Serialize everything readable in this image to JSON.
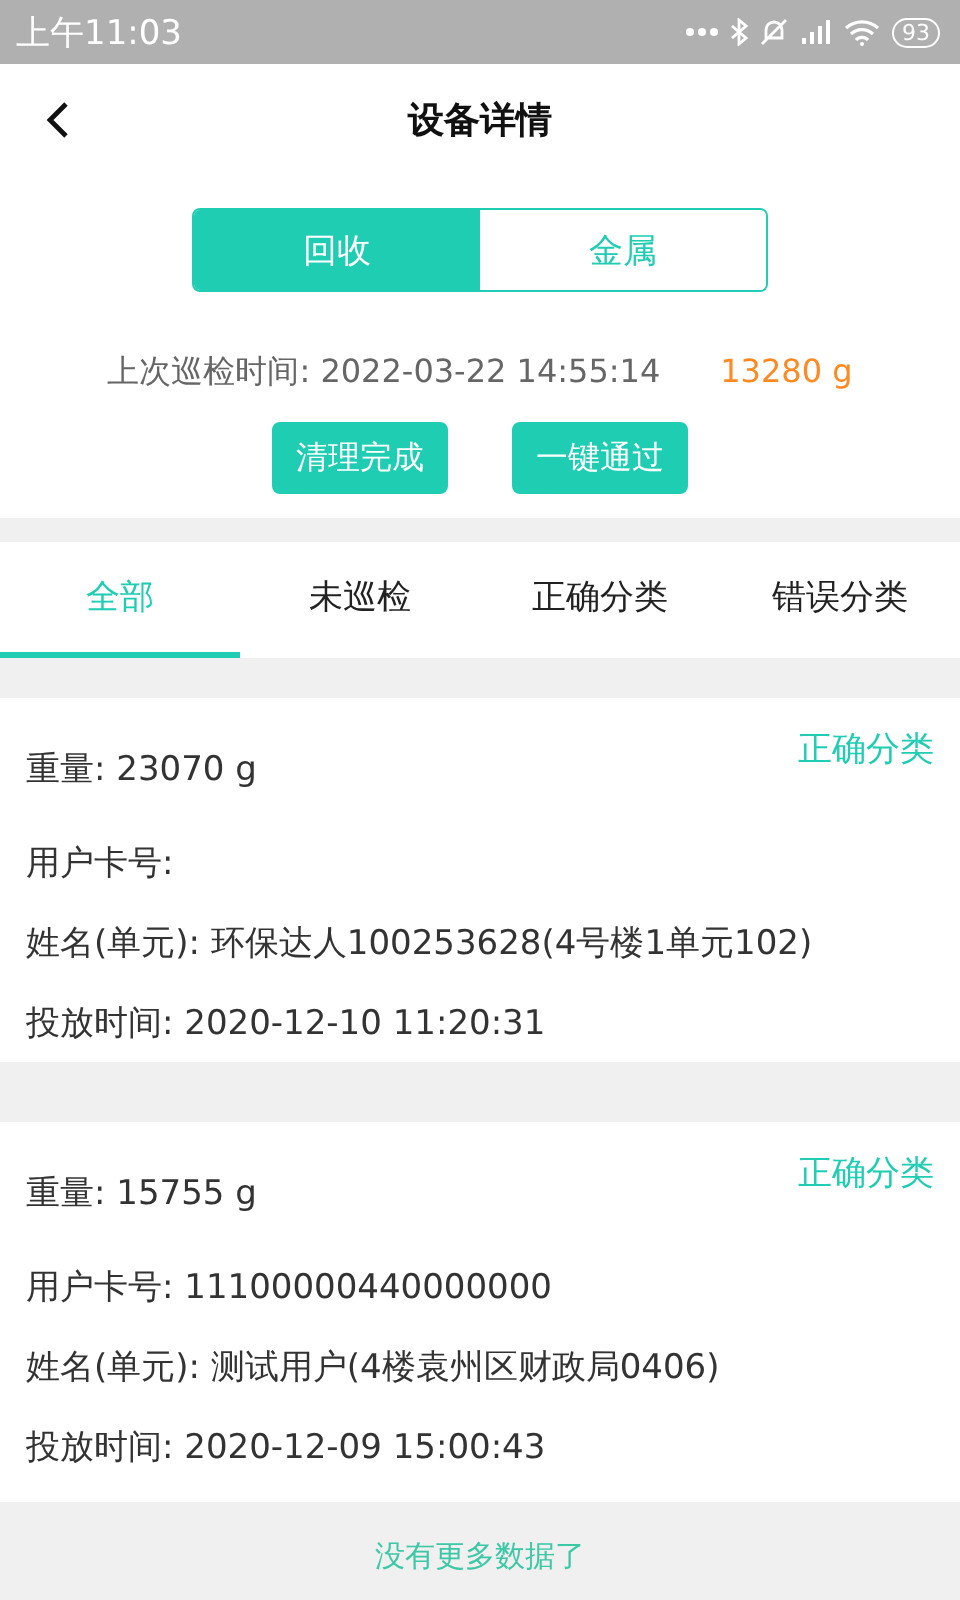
{
  "status_bar": {
    "time": "上午11:03",
    "battery": "93"
  },
  "header": {
    "title": "设备详情"
  },
  "segments": [
    {
      "label": "回收",
      "selected": true
    },
    {
      "label": "金属",
      "selected": false
    }
  ],
  "inspection": {
    "last_time": "上次巡检时间: 2022-03-22 14:55:14",
    "weight": "13280 g",
    "buttons": [
      "清理完成",
      "一键通过"
    ]
  },
  "tabs": [
    {
      "label": "全部",
      "selected": true
    },
    {
      "label": "未巡检",
      "selected": false
    },
    {
      "label": "正确分类",
      "selected": false
    },
    {
      "label": "错误分类",
      "selected": false
    }
  ],
  "records": [
    {
      "weight": "重量: 23070 g",
      "category": "正确分类",
      "fields": [
        "用户卡号:",
        "姓名(单元):  环保达人100253628(4号楼1单元102)",
        "投放时间:  2020-12-10 11:20:31"
      ]
    },
    {
      "weight": "重量: 15755 g",
      "category": "正确分类",
      "fields": [
        "用户卡号: 11100000440000000",
        "姓名(单元):  测试用户(4楼袁州区财政局0406)",
        "投放时间:  2020-12-09 15:00:43"
      ]
    }
  ],
  "footer": "没有更多数据了"
}
